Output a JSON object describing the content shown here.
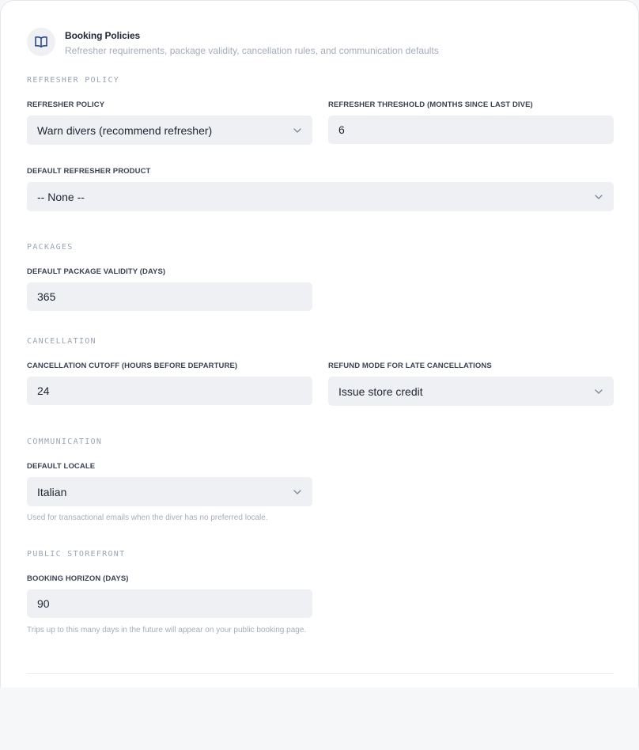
{
  "header": {
    "title": "Booking Policies",
    "subtitle": "Refresher requirements, package validity, cancellation rules, and communication defaults",
    "icon": "book-open-icon"
  },
  "refresher": {
    "heading": "REFRESHER POLICY",
    "policy_label": "REFRESHER POLICY",
    "policy_value": "Warn divers (recommend refresher)",
    "threshold_label": "REFRESHER THRESHOLD (MONTHS SINCE LAST DIVE)",
    "threshold_value": "6",
    "product_label": "DEFAULT REFRESHER PRODUCT",
    "product_value": "-- None --"
  },
  "packages": {
    "heading": "PACKAGES",
    "validity_label": "DEFAULT PACKAGE VALIDITY (DAYS)",
    "validity_value": "365"
  },
  "cancellation": {
    "heading": "CANCELLATION",
    "cutoff_label": "CANCELLATION CUTOFF (HOURS BEFORE DEPARTURE)",
    "cutoff_value": "24",
    "refund_label": "REFUND MODE FOR LATE CANCELLATIONS",
    "refund_value": "Issue store credit"
  },
  "communication": {
    "heading": "COMMUNICATION",
    "locale_label": "DEFAULT LOCALE",
    "locale_value": "Italian",
    "locale_hint": "Used for transactional emails when the diver has no preferred locale."
  },
  "storefront": {
    "heading": "PUBLIC STOREFRONT",
    "horizon_label": "BOOKING HORIZON (DAYS)",
    "horizon_value": "90",
    "horizon_hint": "Trips up to this many days in the future will appear on your public booking page."
  },
  "colors": {
    "field_bg": "#eef0f3",
    "heading": "#9aa4b5",
    "accent": "#2f4a8a"
  }
}
